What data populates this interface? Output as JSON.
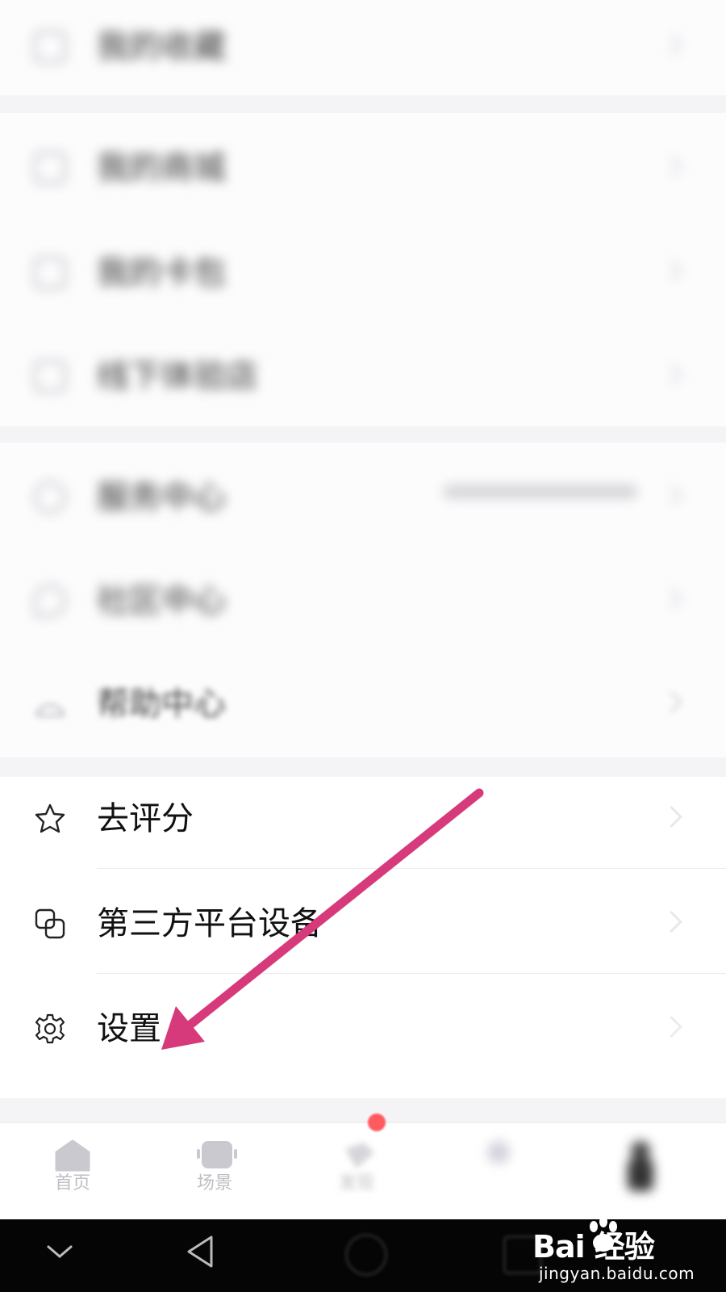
{
  "section1": {
    "label": "我的收藏"
  },
  "section2": {
    "items": [
      {
        "label": "我的商城",
        "icon": "bag-icon"
      },
      {
        "label": "我的卡包",
        "icon": "card-icon"
      },
      {
        "label": "线下体验店",
        "icon": "store-icon"
      }
    ]
  },
  "section3": {
    "items": [
      {
        "label": "服务中心",
        "icon": "headset-icon"
      },
      {
        "label": "社区中心",
        "icon": "chat-icon"
      },
      {
        "label": "帮助中心",
        "icon": "help-icon"
      }
    ]
  },
  "section4": {
    "items": [
      {
        "label": "去评分",
        "icon": "star-icon"
      },
      {
        "label": "第三方平台设备",
        "icon": "devices-icon"
      },
      {
        "label": "设置",
        "icon": "gear-icon"
      }
    ]
  },
  "tabbar": {
    "tabs": [
      {
        "label": "首页",
        "icon": "home-icon"
      },
      {
        "label": "场景",
        "icon": "scene-icon"
      },
      {
        "label": "发现",
        "icon": "discover-icon"
      },
      {
        "label": "",
        "icon": "profile-icon"
      },
      {
        "label": "",
        "icon": "me-icon"
      }
    ]
  },
  "watermark": {
    "logo": "Bai  经验",
    "sub": "jingyan.baidu.com"
  },
  "colors": {
    "arrow": "#d63a7b",
    "badge": "#ff4d4f"
  }
}
